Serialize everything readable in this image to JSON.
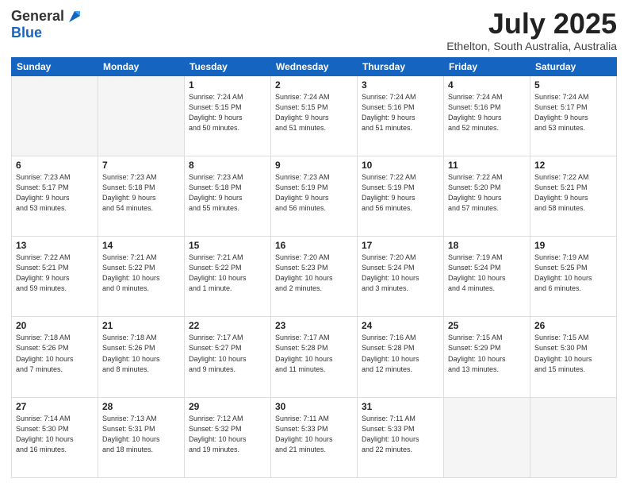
{
  "header": {
    "logo_general": "General",
    "logo_blue": "Blue",
    "main_title": "July 2025",
    "subtitle": "Ethelton, South Australia, Australia"
  },
  "weekdays": [
    "Sunday",
    "Monday",
    "Tuesday",
    "Wednesday",
    "Thursday",
    "Friday",
    "Saturday"
  ],
  "weeks": [
    [
      {
        "day": "",
        "info": ""
      },
      {
        "day": "",
        "info": ""
      },
      {
        "day": "1",
        "info": "Sunrise: 7:24 AM\nSunset: 5:15 PM\nDaylight: 9 hours\nand 50 minutes."
      },
      {
        "day": "2",
        "info": "Sunrise: 7:24 AM\nSunset: 5:15 PM\nDaylight: 9 hours\nand 51 minutes."
      },
      {
        "day": "3",
        "info": "Sunrise: 7:24 AM\nSunset: 5:16 PM\nDaylight: 9 hours\nand 51 minutes."
      },
      {
        "day": "4",
        "info": "Sunrise: 7:24 AM\nSunset: 5:16 PM\nDaylight: 9 hours\nand 52 minutes."
      },
      {
        "day": "5",
        "info": "Sunrise: 7:24 AM\nSunset: 5:17 PM\nDaylight: 9 hours\nand 53 minutes."
      }
    ],
    [
      {
        "day": "6",
        "info": "Sunrise: 7:23 AM\nSunset: 5:17 PM\nDaylight: 9 hours\nand 53 minutes."
      },
      {
        "day": "7",
        "info": "Sunrise: 7:23 AM\nSunset: 5:18 PM\nDaylight: 9 hours\nand 54 minutes."
      },
      {
        "day": "8",
        "info": "Sunrise: 7:23 AM\nSunset: 5:18 PM\nDaylight: 9 hours\nand 55 minutes."
      },
      {
        "day": "9",
        "info": "Sunrise: 7:23 AM\nSunset: 5:19 PM\nDaylight: 9 hours\nand 56 minutes."
      },
      {
        "day": "10",
        "info": "Sunrise: 7:22 AM\nSunset: 5:19 PM\nDaylight: 9 hours\nand 56 minutes."
      },
      {
        "day": "11",
        "info": "Sunrise: 7:22 AM\nSunset: 5:20 PM\nDaylight: 9 hours\nand 57 minutes."
      },
      {
        "day": "12",
        "info": "Sunrise: 7:22 AM\nSunset: 5:21 PM\nDaylight: 9 hours\nand 58 minutes."
      }
    ],
    [
      {
        "day": "13",
        "info": "Sunrise: 7:22 AM\nSunset: 5:21 PM\nDaylight: 9 hours\nand 59 minutes."
      },
      {
        "day": "14",
        "info": "Sunrise: 7:21 AM\nSunset: 5:22 PM\nDaylight: 10 hours\nand 0 minutes."
      },
      {
        "day": "15",
        "info": "Sunrise: 7:21 AM\nSunset: 5:22 PM\nDaylight: 10 hours\nand 1 minute."
      },
      {
        "day": "16",
        "info": "Sunrise: 7:20 AM\nSunset: 5:23 PM\nDaylight: 10 hours\nand 2 minutes."
      },
      {
        "day": "17",
        "info": "Sunrise: 7:20 AM\nSunset: 5:24 PM\nDaylight: 10 hours\nand 3 minutes."
      },
      {
        "day": "18",
        "info": "Sunrise: 7:19 AM\nSunset: 5:24 PM\nDaylight: 10 hours\nand 4 minutes."
      },
      {
        "day": "19",
        "info": "Sunrise: 7:19 AM\nSunset: 5:25 PM\nDaylight: 10 hours\nand 6 minutes."
      }
    ],
    [
      {
        "day": "20",
        "info": "Sunrise: 7:18 AM\nSunset: 5:26 PM\nDaylight: 10 hours\nand 7 minutes."
      },
      {
        "day": "21",
        "info": "Sunrise: 7:18 AM\nSunset: 5:26 PM\nDaylight: 10 hours\nand 8 minutes."
      },
      {
        "day": "22",
        "info": "Sunrise: 7:17 AM\nSunset: 5:27 PM\nDaylight: 10 hours\nand 9 minutes."
      },
      {
        "day": "23",
        "info": "Sunrise: 7:17 AM\nSunset: 5:28 PM\nDaylight: 10 hours\nand 11 minutes."
      },
      {
        "day": "24",
        "info": "Sunrise: 7:16 AM\nSunset: 5:28 PM\nDaylight: 10 hours\nand 12 minutes."
      },
      {
        "day": "25",
        "info": "Sunrise: 7:15 AM\nSunset: 5:29 PM\nDaylight: 10 hours\nand 13 minutes."
      },
      {
        "day": "26",
        "info": "Sunrise: 7:15 AM\nSunset: 5:30 PM\nDaylight: 10 hours\nand 15 minutes."
      }
    ],
    [
      {
        "day": "27",
        "info": "Sunrise: 7:14 AM\nSunset: 5:30 PM\nDaylight: 10 hours\nand 16 minutes."
      },
      {
        "day": "28",
        "info": "Sunrise: 7:13 AM\nSunset: 5:31 PM\nDaylight: 10 hours\nand 18 minutes."
      },
      {
        "day": "29",
        "info": "Sunrise: 7:12 AM\nSunset: 5:32 PM\nDaylight: 10 hours\nand 19 minutes."
      },
      {
        "day": "30",
        "info": "Sunrise: 7:11 AM\nSunset: 5:33 PM\nDaylight: 10 hours\nand 21 minutes."
      },
      {
        "day": "31",
        "info": "Sunrise: 7:11 AM\nSunset: 5:33 PM\nDaylight: 10 hours\nand 22 minutes."
      },
      {
        "day": "",
        "info": ""
      },
      {
        "day": "",
        "info": ""
      }
    ]
  ]
}
